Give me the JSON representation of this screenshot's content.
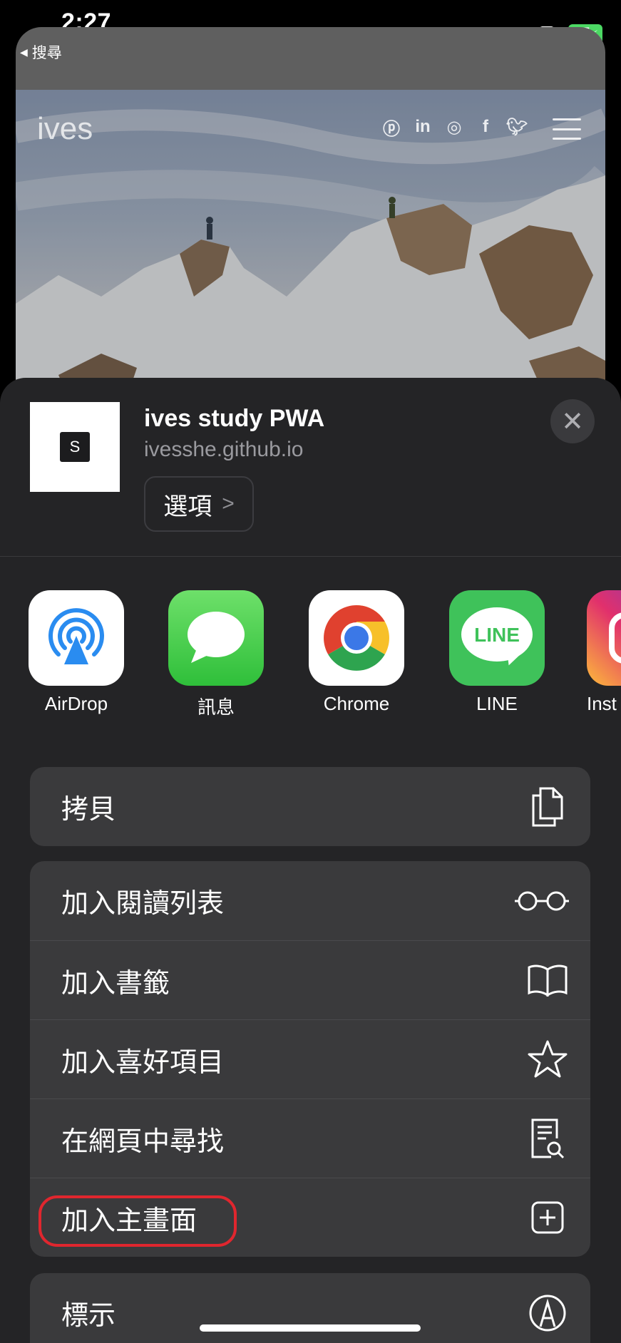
{
  "status_bar": {
    "time": "2:27",
    "battery": "95"
  },
  "browser": {
    "back_label": "搜尋",
    "site_logo": "ives",
    "social_icons": [
      "pinterest-icon",
      "linkedin-icon",
      "instagram-icon",
      "facebook-icon",
      "twitter-icon"
    ]
  },
  "share_sheet": {
    "app_icon_letter": "S",
    "title": "ives study PWA",
    "url": "ivesshe.github.io",
    "options_label": "選項",
    "apps": [
      {
        "label": "AirDrop",
        "icon": "airdrop-icon"
      },
      {
        "label": "訊息",
        "icon": "messages-icon"
      },
      {
        "label": "Chrome",
        "icon": "chrome-icon"
      },
      {
        "label": "LINE",
        "icon": "line-icon",
        "icon_text": "LINE"
      },
      {
        "label": "Inst",
        "icon": "instagram-icon"
      }
    ],
    "copy_label": "拷貝",
    "actions": [
      {
        "label": "加入閱讀列表",
        "icon": "glasses-icon"
      },
      {
        "label": "加入書籤",
        "icon": "book-icon"
      },
      {
        "label": "加入喜好項目",
        "icon": "star-icon"
      },
      {
        "label": "在網頁中尋找",
        "icon": "find-in-page-icon"
      },
      {
        "label": "加入主畫面",
        "icon": "add-square-icon",
        "highlighted": true
      }
    ],
    "markup_label": "標示"
  },
  "colors": {
    "sheet_bg": "#242426",
    "row_bg": "#3a3a3c",
    "highlight": "#e0262e",
    "battery": "#4cd964"
  }
}
